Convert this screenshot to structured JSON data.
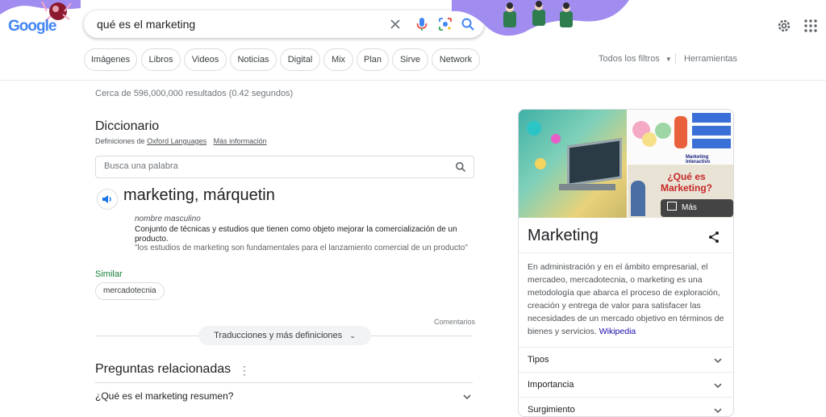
{
  "header": {
    "logo_text": "Google",
    "query": "qué es el marketing",
    "icons": [
      "clear-icon",
      "mic-icon",
      "lens-icon",
      "search-icon",
      "settings-icon",
      "apps-icon"
    ]
  },
  "filters": {
    "chips": [
      "Imágenes",
      "Libros",
      "Videos",
      "Noticias",
      "Digital",
      "Mix",
      "Plan",
      "Sirve",
      "Network"
    ],
    "all_filters": "Todos los filtros",
    "tools": "Herramientas"
  },
  "stats": "Cerca de 596,000,000 resultados (0.42 segundos)",
  "dictionary": {
    "title": "Diccionario",
    "source_prefix": "Definiciones de",
    "source": "Oxford Languages",
    "more_info": "Más información",
    "search_placeholder": "Busca una palabra",
    "word": "marketing, márquetin",
    "part_of_speech": "nombre masculino",
    "definition": "Conjunto de técnicas y estudios que tienen como objeto mejorar la comercialización de un producto.",
    "example": "\"los estudios de marketing son fundamentales para el lanzamiento comercial de un producto\"",
    "similar_label": "Similar",
    "synonym": "mercadotecnia",
    "comments": "Comentarios",
    "more_button": "Traducciones y más definiciones"
  },
  "related": {
    "title": "Preguntas relacionadas",
    "questions": [
      "¿Qué es el marketing resumen?"
    ]
  },
  "knowledge_panel": {
    "more_images": "Más imágenes",
    "image_texts": [
      "¿Qué es",
      "Marketing?",
      "Marketing Interactivo"
    ],
    "title": "Marketing",
    "description": "En administración y en el ámbito empresarial, el mercadeo, mercadotecnia, o marketing es una metodología que abarca el proceso de exploración, creación y entrega de valor para satisfacer las necesidades de un mercado objetivo en términos de bienes y servicios.",
    "source": "Wikipedia",
    "rows": [
      "Tipos",
      "Importancia",
      "Surgimiento"
    ]
  },
  "colors": {
    "accent": "#1a73e8",
    "green": "#188038",
    "doodle": "#a18cf0"
  }
}
